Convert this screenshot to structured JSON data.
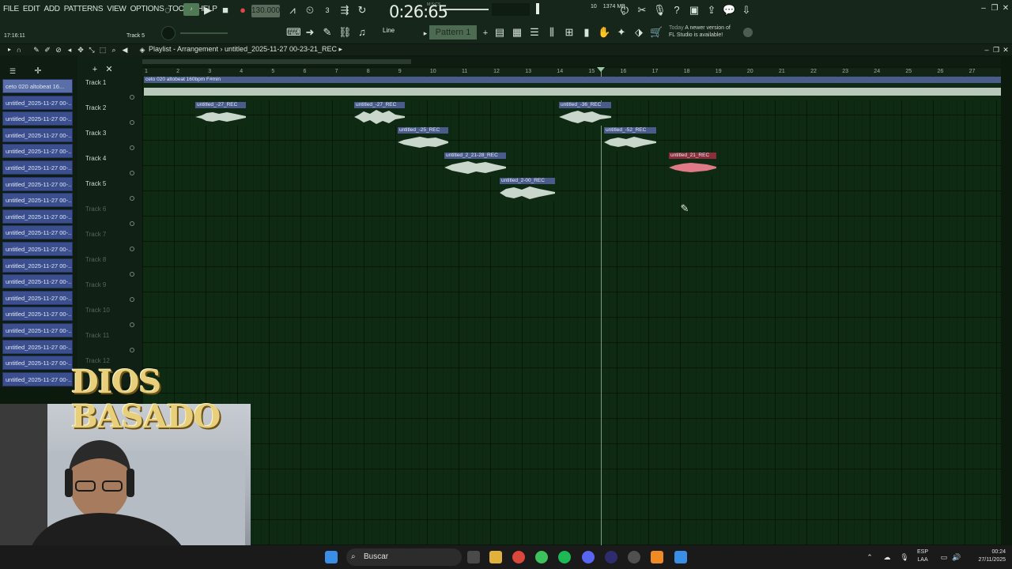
{
  "menu": [
    "FILE",
    "EDIT",
    "ADD",
    "PATTERNS",
    "VIEW",
    "OPTIONS",
    "TOOLS",
    "HELP"
  ],
  "transport": {
    "tempo": "130.000",
    "clock": "0:26:65",
    "clock_sub": "M:S:CS"
  },
  "toolbar": {
    "pattern": "Pattern 1",
    "snap": "Line",
    "mem_top": "10",
    "mem_value": "1374 MB",
    "mem_bottom": "0"
  },
  "hint": {
    "line1": "Today",
    "line2": "A newer version of",
    "line3": "FL Studio is available!"
  },
  "status": {
    "time": "17:16:11",
    "track_hint": "Track 5"
  },
  "window": {
    "title": "Playlist - Arrangement",
    "path": "untitled_2025-11-27 00-23-21_REC"
  },
  "browser": {
    "items": [
      "ceto 020 altobeat 16...",
      "untitled_2025-11-27 00-...",
      "untitled_2025-11-27 00-...",
      "untitled_2025-11-27 00-...",
      "untitled_2025-11-27 00-...",
      "untitled_2025-11-27 00-...",
      "untitled_2025-11-27 00-...",
      "untitled_2025-11-27 00-...",
      "untitled_2025-11-27 00-...",
      "untitled_2025-11-27 00-...",
      "untitled_2025-11-27 00-...",
      "untitled_2025-11-27 00-...",
      "untitled_2025-11-27 00-...",
      "untitled_2025-11-27 00-...",
      "untitled_2025-11-27 00-...",
      "untitled_2025-11-27 00-...",
      "untitled_2025-11-27 00-...",
      "untitled_2025-11-27 00-...",
      "untitled_2025-11-27 00-..."
    ]
  },
  "tracks": [
    "Track 1",
    "Track 2",
    "Track 3",
    "Track 4",
    "Track 5",
    "Track 6",
    "Track 7",
    "Track 8",
    "Track 9",
    "Track 10",
    "Track 11",
    "Track 12"
  ],
  "ruler": [
    "1",
    "2",
    "3",
    "4",
    "5",
    "6",
    "7",
    "8",
    "9",
    "10",
    "11",
    "12",
    "13",
    "14",
    "15",
    "16",
    "17",
    "18",
    "19",
    "20",
    "21",
    "22",
    "23",
    "24",
    "25",
    "26",
    "27"
  ],
  "clips": {
    "main": "ceto 020 altobeat 160bpm F#min",
    "c1": "untitled_-27_REC",
    "c2": "untitled_-27_REC",
    "c3": "untitled_-36_REC",
    "c4": "untitled_-25_REC",
    "c5": "untitled_-52_REC",
    "c6": "untitled_2_21-28_REC",
    "c7": "untitled_21_REC",
    "c8": "untitled_2-00_REC"
  },
  "overlay": {
    "line1": "DIOS",
    "line2": "BASADO"
  },
  "taskbar": {
    "search": "Buscar",
    "lang1": "ESP",
    "lang2": "LAA",
    "time": "00:24",
    "date": "27/11/2025"
  },
  "colors": {
    "grid": "#0f2a12",
    "clip": "#4a5b8c",
    "clip_red": "#8c2d3a",
    "browser_item": "#3b4f8f"
  }
}
